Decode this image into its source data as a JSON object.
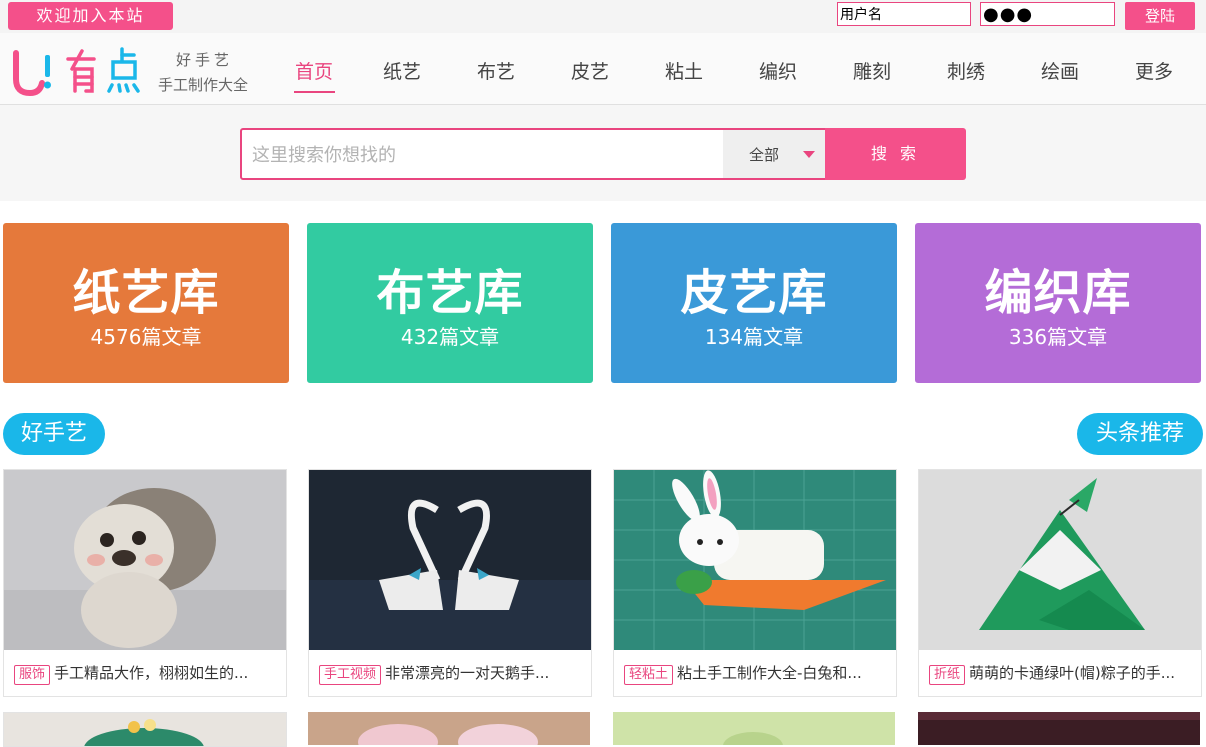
{
  "topbar": {
    "welcome": "欢迎加入本站",
    "username_value": "用户名",
    "password_value": "●●●",
    "login_label": "登陆"
  },
  "header": {
    "logo_tagline": "好手艺",
    "logo_subtitle": "手工制作大全",
    "nav": [
      "首页",
      "纸艺",
      "布艺",
      "皮艺",
      "粘土",
      "编织",
      "雕刻",
      "刺绣",
      "绘画",
      "更多"
    ],
    "active_nav": "首页"
  },
  "search": {
    "placeholder": "这里搜索你想找的",
    "scope": "全部",
    "button": "搜 索"
  },
  "libraries": [
    {
      "title": "纸艺库",
      "count": "4576篇文章",
      "color": "#e5793b"
    },
    {
      "title": "布艺库",
      "count": "432篇文章",
      "color": "#32cba1"
    },
    {
      "title": "皮艺库",
      "count": "134篇文章",
      "color": "#3a99d8"
    },
    {
      "title": "编织库",
      "count": "336篇文章",
      "color": "#b46cd7"
    }
  ],
  "sections": {
    "left_label": "好手艺",
    "right_label": "头条推荐"
  },
  "cards": [
    {
      "tag": "服饰",
      "title": "手工精品大作，栩栩如生的...",
      "image": "felted-hedgehog"
    },
    {
      "tag": "手工视频",
      "title": "非常漂亮的一对天鹅手...",
      "image": "origami-swans"
    },
    {
      "tag": "轻粘土",
      "title": "粘土手工制作大全-白兔和...",
      "image": "clay-rabbit-carrot"
    },
    {
      "tag": "折纸",
      "title": "萌萌的卡通绿叶(帽)粽子的手...",
      "image": "origami-zongzi"
    }
  ],
  "colors": {
    "accent": "#f4508a",
    "section_pill": "#1ab7e9"
  }
}
